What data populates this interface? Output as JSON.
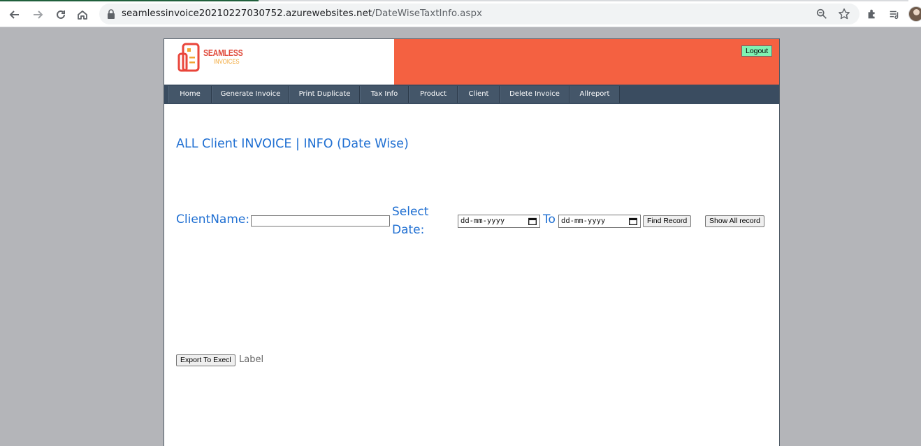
{
  "browser": {
    "url_host": "seamlessinvoice20210227030752.azurewebsites.net",
    "url_path": "/DateWiseTaxtInfo.aspx"
  },
  "brand": {
    "name_line1": "SEAMLESS",
    "name_line2": "INVOICES"
  },
  "header": {
    "logout_label": "Logout"
  },
  "menu": {
    "items": [
      {
        "label": "Home"
      },
      {
        "label": "Generate Invoice"
      },
      {
        "label": "Print Duplicate"
      },
      {
        "label": "Tax Info"
      },
      {
        "label": "Product"
      },
      {
        "label": "Client"
      },
      {
        "label": "Delete Invoice"
      },
      {
        "label": "Allreport"
      }
    ]
  },
  "main": {
    "title": "ALL Client INVOICE | INFO (Date Wise)",
    "client_label": "ClientName:",
    "client_value": "",
    "select_date_line1": "Select",
    "select_date_line2": "Date:",
    "from_date_placeholder": "dd-mm-yyyy",
    "to_label": "To",
    "to_date_placeholder": "dd-mm-yyyy",
    "find_record_label": "Find Record",
    "show_all_label": "Show All record",
    "export_label": "Export To Execl",
    "status_label": "Label"
  },
  "colors": {
    "header_accent": "#f46141",
    "menu_bg": "#3a4c60",
    "title_blue": "#1f6fd2",
    "logout_bg": "#7ff2b2"
  }
}
